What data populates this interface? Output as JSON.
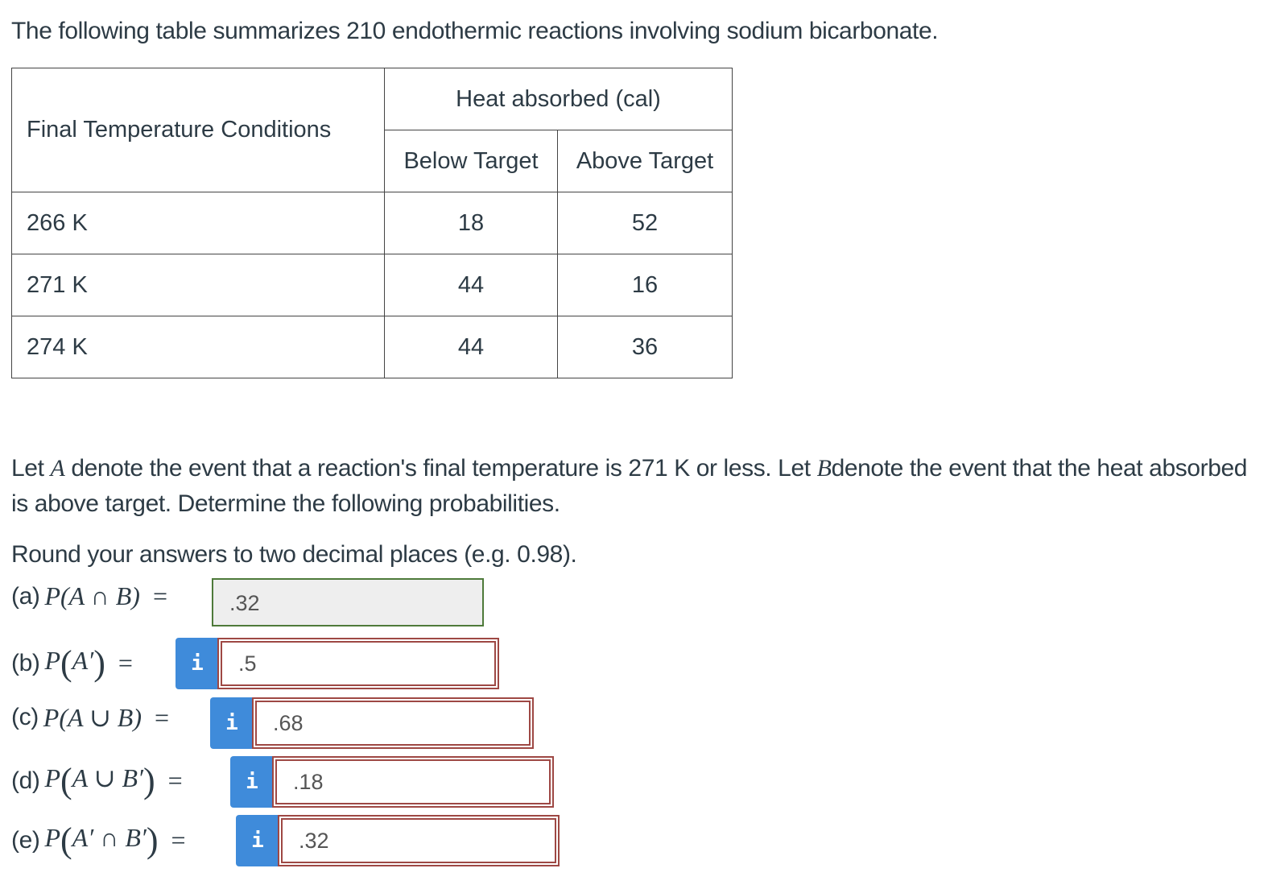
{
  "intro": "The following table summarizes 210 endothermic reactions involving sodium bicarbonate.",
  "table": {
    "row_header": "Final Temperature Conditions",
    "group_header": "Heat absorbed (cal)",
    "columns": [
      "Below Target",
      "Above Target"
    ],
    "rows": [
      {
        "label": "266 K",
        "values": [
          "18",
          "52"
        ]
      },
      {
        "label": "271 K",
        "values": [
          "44",
          "16"
        ]
      },
      {
        "label": "274 K",
        "values": [
          "44",
          "36"
        ]
      }
    ]
  },
  "paragraph": {
    "p1": "Let ",
    "varA": "A",
    "p2": " denote the event that a reaction's final temperature is 271 K or less. Let ",
    "varB": "B",
    "p3": "denote the event that the heat absorbed is above target. Determine the following probabilities."
  },
  "round_instruction": "Round your answers to two decimal places (e.g. 0.98).",
  "questions": [
    {
      "label": "(a)",
      "expr": "P(A ∩ B)",
      "eq": "=",
      "answer": ".32",
      "status": "correct",
      "icon": "info-icon"
    },
    {
      "label": "(b)",
      "expr_p": "P",
      "expr_inner": "A′",
      "eq": "=",
      "answer": ".5",
      "status": "incorrect",
      "icon": "i"
    },
    {
      "label": "(c)",
      "expr": "P(A ∪ B)",
      "eq": "=",
      "answer": ".68",
      "status": "incorrect",
      "icon": "i"
    },
    {
      "label": "(d)",
      "expr_p": "P",
      "expr_inner": "A ∪ B′",
      "eq": "=",
      "answer": ".18",
      "status": "incorrect",
      "icon": "i"
    },
    {
      "label": "(e)",
      "expr_p": "P",
      "expr_inner": "A′ ∩ B′",
      "eq": "=",
      "answer": ".32",
      "status": "incorrect",
      "icon": "i"
    }
  ],
  "colors": {
    "correct_border": "#4e7a3a",
    "incorrect_border": "#9e4844",
    "info_button": "#3f8bda"
  }
}
